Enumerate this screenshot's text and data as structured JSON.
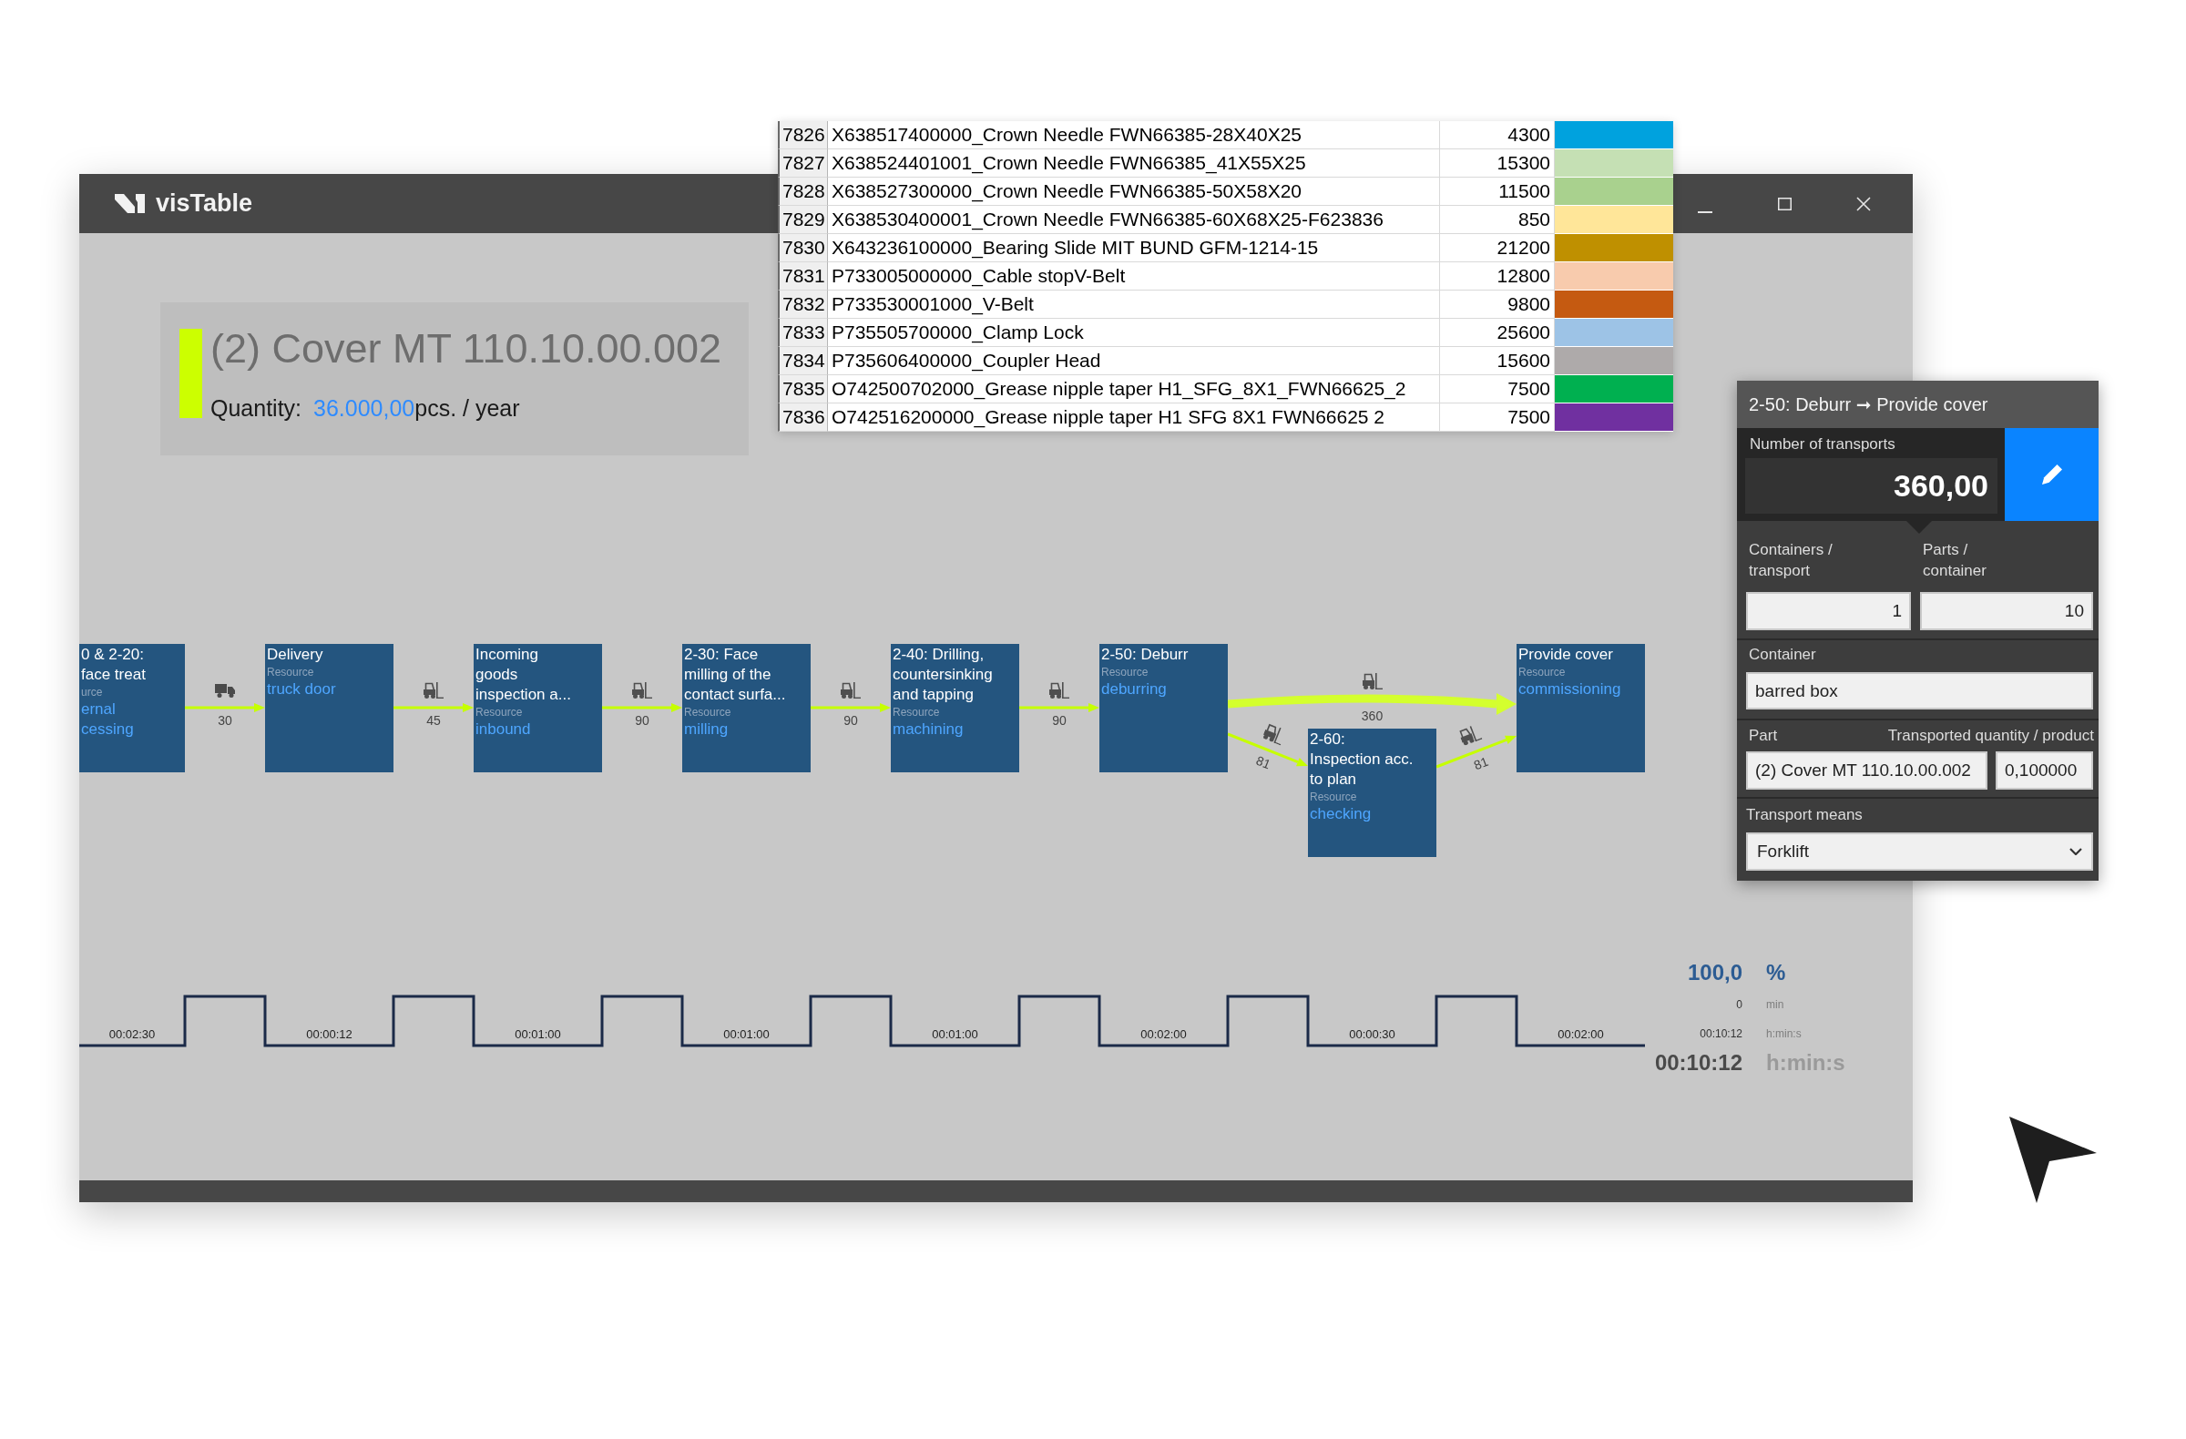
{
  "window": {
    "title": "visTable"
  },
  "spreadsheet": {
    "rows": [
      {
        "row_number": "7826",
        "column_1": "X638517400000_Crown Needle FWN66385-28X40X25",
        "column_2": "4300",
        "color": "#00a2de"
      },
      {
        "row_number": "7827",
        "column_1": "X638524401001_Crown Needle FWN66385_41X55X25",
        "column_2": "15300",
        "color": "#c5e0b4"
      },
      {
        "row_number": "7828",
        "column_1": "X638527300000_Crown Needle FWN66385-50X58X20",
        "column_2": "11500",
        "color": "#a9d18e"
      },
      {
        "row_number": "7829",
        "column_1": "X638530400001_Crown Needle FWN66385-60X68X25-F623836",
        "column_2": "850",
        "color": "#ffe699"
      },
      {
        "row_number": "7830",
        "column_1": "X643236100000_Bearing Slide MIT BUND GFM-1214-15",
        "column_2": "21200",
        "color": "#bf9000"
      },
      {
        "row_number": "7831",
        "column_1": "P733005000000_Cable stopV-Belt",
        "column_2": "12800",
        "color": "#f8cbad"
      },
      {
        "row_number": "7832",
        "column_1": "P733530001000_V-Belt",
        "column_2": "9800",
        "color": "#c55a11"
      },
      {
        "row_number": "7833",
        "column_1": "P735505700000_Clamp Lock",
        "column_2": "25600",
        "color": "#9dc3e6"
      },
      {
        "row_number": "7834",
        "column_1": "P735606400000_Coupler Head",
        "column_2": "15600",
        "color": "#aeaaaa"
      },
      {
        "row_number": "7835",
        "column_1": "O742500702000_Grease nipple taper H1_SFG_8X1_FWN66625_2",
        "column_2": "7500",
        "color": "#00b050"
      },
      {
        "row_number": "7836",
        "column_1": "O742516200000_Grease nipple taper H1 SFG 8X1 FWN66625 2",
        "column_2": "7500",
        "color": "#7030a0"
      }
    ]
  },
  "part_header": {
    "title": "(2) Cover MT 110.10.00.002",
    "quantity_label": "Quantity:",
    "quantity_value": "36.000,00",
    "quantity_unit": "pcs. / year"
  },
  "transport_panel": {
    "title": "2-50: Deburr ➞ Provide cover",
    "number_of_transports": {
      "label": "Number of transports",
      "value": "360,00"
    },
    "containers_per_transport": {
      "label": "Containers / transport",
      "value": "1"
    },
    "parts_per_container": {
      "label": "Parts / container",
      "value": "10"
    },
    "container": {
      "label": "Container",
      "value": "barred box"
    },
    "part": {
      "label": "Part",
      "value": "(2) Cover MT 110.10.00.002"
    },
    "transported_quantity": {
      "label": "Transported quantity / product",
      "value": "0,100000"
    },
    "transport_means": {
      "label": "Transport means",
      "value": "Forklift"
    }
  },
  "process_flow": {
    "steps": [
      {
        "kind": "operation",
        "title_lines": [
          "0 & 2-20:",
          "face treat"
        ],
        "resource_label": "urce",
        "resource_lines": [
          "ernal",
          "cessing"
        ]
      },
      {
        "kind": "truck",
        "count": "30",
        "selected": false
      },
      {
        "kind": "operation",
        "title_lines": [
          "Delivery"
        ],
        "resource_label": "Resource",
        "resource_lines": [
          "truck door"
        ]
      },
      {
        "kind": "forklift",
        "count": "45",
        "selected": false
      },
      {
        "kind": "operation",
        "title_lines": [
          "Incoming",
          "goods",
          "inspection a..."
        ],
        "resource_label": "Resource",
        "resource_lines": [
          "inbound"
        ]
      },
      {
        "kind": "forklift",
        "count": "90",
        "selected": false
      },
      {
        "kind": "operation",
        "title_lines": [
          "2-30: Face",
          "milling of the",
          "contact surfa..."
        ],
        "resource_label": "Resource",
        "resource_lines": [
          "milling"
        ]
      },
      {
        "kind": "forklift",
        "count": "90",
        "selected": false
      },
      {
        "kind": "operation",
        "title_lines": [
          "2-40: Drilling,",
          "countersinking",
          "and tapping"
        ],
        "resource_label": "Resource",
        "resource_lines": [
          "machining"
        ]
      },
      {
        "kind": "forklift",
        "count": "90",
        "selected": false
      },
      {
        "kind": "operation",
        "title_lines": [
          "2-50: Deburr"
        ],
        "resource_label": "Resource",
        "resource_lines": [
          "deburring"
        ]
      },
      {
        "kind": "branch",
        "direct": {
          "kind": "forklift",
          "count": "360",
          "selected": true
        },
        "detour": [
          {
            "kind": "forklift",
            "count": "81",
            "selected": false
          },
          {
            "kind": "operation",
            "title_lines": [
              "2-60:",
              "Inspection acc.",
              "to plan"
            ],
            "resource_label": "Resource",
            "resource_lines": [
              "checking"
            ]
          },
          {
            "kind": "forklift",
            "count": "81",
            "selected": false
          }
        ]
      },
      {
        "kind": "operation",
        "title_lines": [
          "Provide cover"
        ],
        "resource_label": "Resource",
        "resource_lines": [
          "commissioning"
        ]
      }
    ]
  },
  "timeline": {
    "durations": [
      "00:02:30",
      "00:00:12",
      "00:01:00",
      "00:01:00",
      "00:01:00",
      "00:02:00",
      "00:00:30",
      "00:02:00"
    ]
  },
  "summary": {
    "rows": [
      {
        "kind": "primary",
        "value": "100,0",
        "unit": "%"
      },
      {
        "kind": "secondary",
        "value": "0",
        "unit": "min"
      },
      {
        "kind": "secondary",
        "value": "00:10:12",
        "unit": "h:min:s"
      },
      {
        "kind": "total",
        "value": "00:10:12",
        "unit": "h:min:s"
      }
    ]
  }
}
